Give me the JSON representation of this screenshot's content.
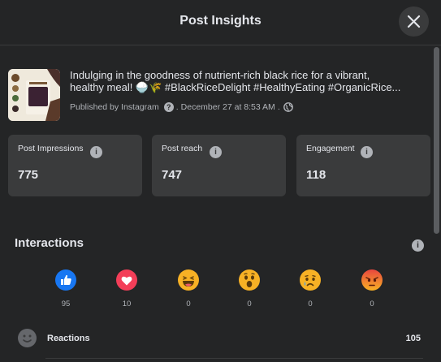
{
  "header": {
    "title": "Post Insights"
  },
  "post": {
    "text_line1": "Indulging in the goodness of nutrient-rich black rice for a vibrant,",
    "text_line2": "healthy meal! 🍚🌾 #BlackRiceDelight #HealthyEating #OrganicRice...",
    "published_by": "Published by Instagram",
    "sep1": ".",
    "date": "December 27 at 8:53 AM",
    "sep2": "."
  },
  "metrics": [
    {
      "label": "Post Impressions",
      "value": "775"
    },
    {
      "label": "Post reach",
      "value": "747"
    },
    {
      "label": "Engagement",
      "value": "118"
    }
  ],
  "interactions": {
    "title": "Interactions",
    "reactions": [
      {
        "type": "like",
        "count": "95"
      },
      {
        "type": "love",
        "count": "10"
      },
      {
        "type": "haha",
        "count": "0"
      },
      {
        "type": "wow",
        "count": "0"
      },
      {
        "type": "sad",
        "count": "0"
      },
      {
        "type": "angry",
        "count": "0"
      }
    ],
    "summary_label": "Reactions",
    "summary_value": "105"
  },
  "colors": {
    "background": "#242526",
    "card": "#3a3b3c",
    "like_blue": "#1877f2",
    "love_red": "#f33e58",
    "emoji_yellow": "#f7b125",
    "angry_red": "#e9710f"
  },
  "icons": {
    "close": "close-icon",
    "info": "info-icon",
    "question": "question-icon",
    "globe": "globe-icon",
    "smile": "smile-icon"
  }
}
